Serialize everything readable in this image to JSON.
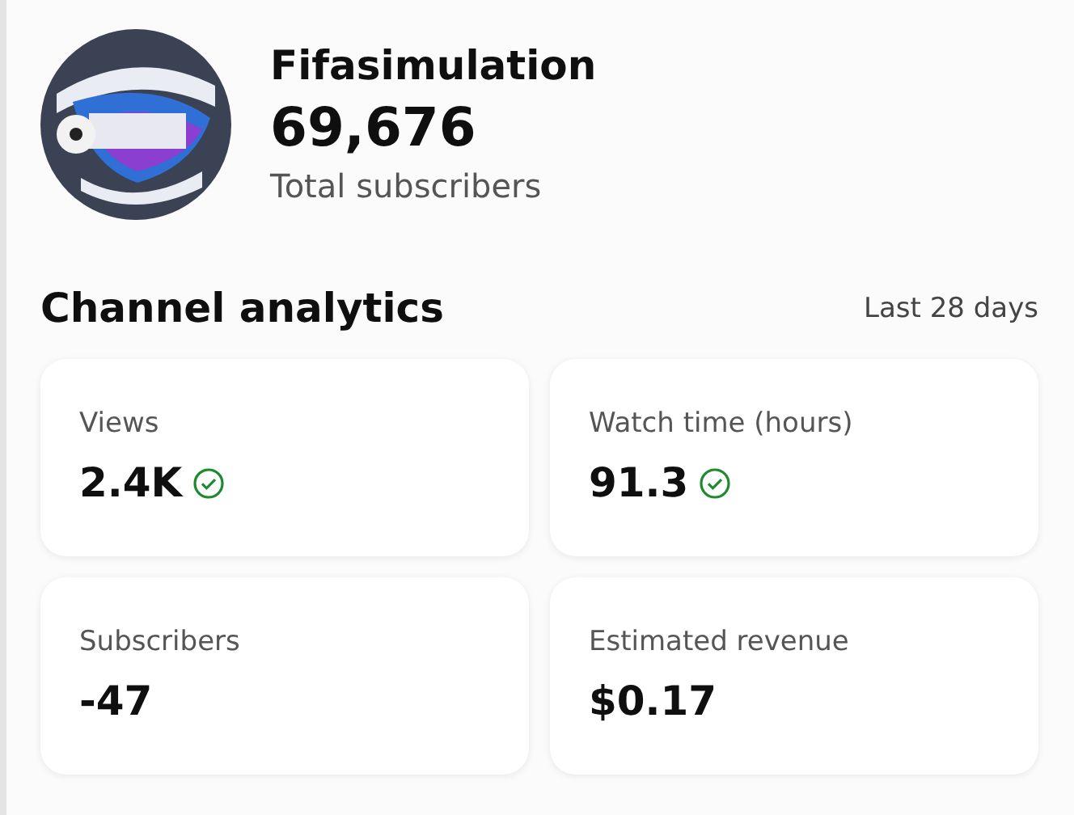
{
  "channel": {
    "name": "Fifasimulation",
    "subscribers": "69,676",
    "subscribers_label": "Total subscribers"
  },
  "analytics": {
    "title": "Channel analytics",
    "period": "Last 28 days",
    "metrics": [
      {
        "label": "Views",
        "value": "2.4K",
        "checked": true
      },
      {
        "label": "Watch time (hours)",
        "value": "91.3",
        "checked": true
      },
      {
        "label": "Subscribers",
        "value": "-47",
        "checked": false
      },
      {
        "label": "Estimated revenue",
        "value": "$0.17",
        "checked": false
      }
    ]
  }
}
